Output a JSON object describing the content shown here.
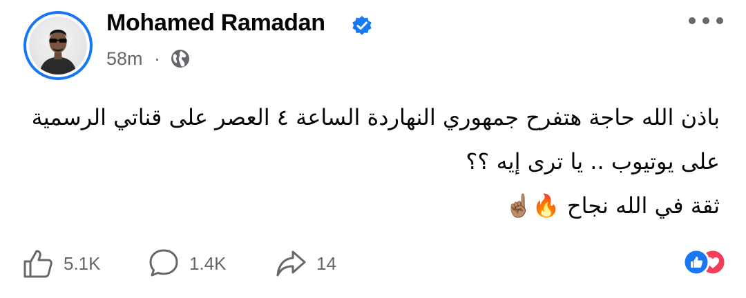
{
  "author": {
    "name": "Mohamed Ramadan",
    "verified": true,
    "timestamp": "58m",
    "separator": "·",
    "audience_icon": "globe-icon"
  },
  "post": {
    "lines": [
      "باذن الله حاجة هتفرح جمهوري النهاردة الساعة ٤ العصر على قناتي الرسمية",
      "على يوتيوب .. يا ترى إيه ؟؟",
      "ثقة في الله نجاح"
    ],
    "emojis": "🔥☝🏽"
  },
  "actions": {
    "like_count": "5.1K",
    "comment_count": "1.4K",
    "share_count": "14"
  },
  "reactions": [
    "like-reaction-icon",
    "love-reaction-icon"
  ],
  "colors": {
    "accent": "#1877f2",
    "secondary_text": "#65676b",
    "love": "#f33e58"
  }
}
